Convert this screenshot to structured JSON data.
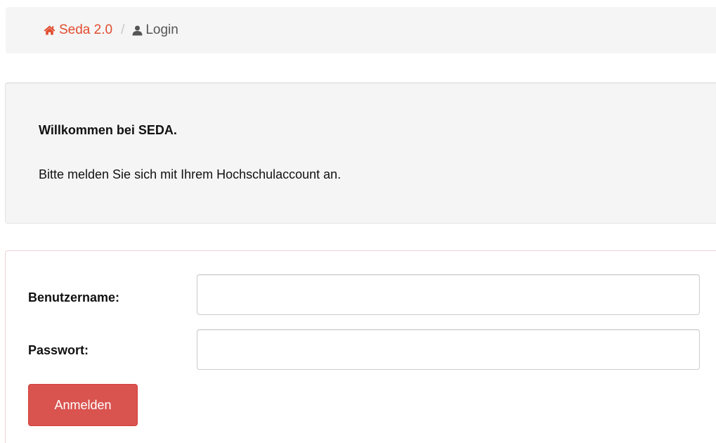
{
  "breadcrumb": {
    "home_label": "Seda 2.0",
    "home_icon": "home-icon",
    "separator": "/",
    "current_label": "Login",
    "current_icon": "user-icon"
  },
  "welcome": {
    "title": "Willkommen bei SEDA.",
    "text": "Bitte melden Sie sich mit Ihrem Hochschulaccount an."
  },
  "login": {
    "username_label": "Benutzername:",
    "username_value": "",
    "password_label": "Passwort:",
    "password_value": "",
    "submit_label": "Anmelden"
  },
  "colors": {
    "accent": "#e14c2f",
    "button": "#d9534f",
    "panel_background": "#f5f5f5",
    "panel_border": "#f0d3d6"
  }
}
